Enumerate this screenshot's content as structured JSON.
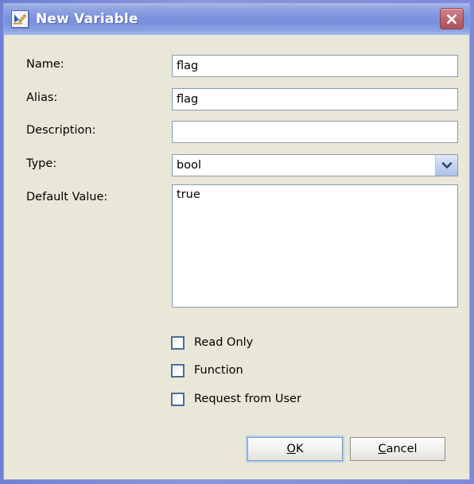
{
  "window": {
    "title": "New Variable",
    "icon": "variable-edit-icon",
    "close_icon": "close-icon",
    "accent_titlebar": "#7d93dd",
    "client_background": "#e9e7d8",
    "border_color": "#7d8ada"
  },
  "form": {
    "fields": [
      {
        "label": "Name:",
        "value": "flag",
        "placeholder": "",
        "kind": "text"
      },
      {
        "label": "Alias:",
        "value": "flag",
        "placeholder": "",
        "kind": "text"
      },
      {
        "label": "Description:",
        "value": "",
        "placeholder": "",
        "kind": "text"
      },
      {
        "label": "Type:",
        "value": "bool",
        "placeholder": "",
        "kind": "select"
      },
      {
        "label": "Default Value:",
        "value": "true",
        "placeholder": "",
        "kind": "textarea"
      }
    ],
    "type_options": [
      "bool"
    ],
    "dropdown_icon": "chevron-down-icon"
  },
  "checkboxes": [
    {
      "label": "Read Only",
      "checked": false
    },
    {
      "label": "Function",
      "checked": false
    },
    {
      "label": "Request from User",
      "checked": false
    }
  ],
  "buttons": {
    "ok": {
      "label": "OK",
      "accel": "O",
      "default": true
    },
    "cancel": {
      "label": "Cancel",
      "accel": "C",
      "default": false
    }
  }
}
